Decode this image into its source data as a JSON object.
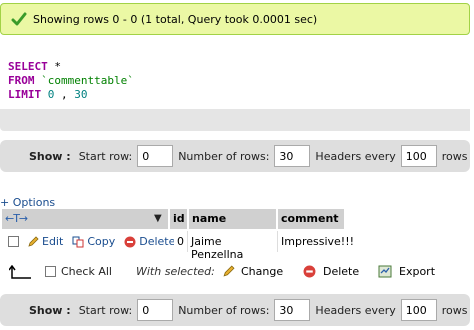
{
  "message": {
    "icon": "checkmark-icon",
    "text": "Showing rows 0 - 0 (1 total, Query took 0.0001 sec)"
  },
  "sql": {
    "select_kw": "SELECT",
    "select_rest": " *",
    "from_kw": "FROM",
    "table": " `commenttable`",
    "limit_kw": "LIMIT",
    "limit_start": " 0",
    "comma": " ,",
    "limit_count": " 30"
  },
  "nav": {
    "show_label": "Show :",
    "start_row_label": "Start row:",
    "start_row_value": "0",
    "num_rows_label": "Number of rows:",
    "num_rows_value": "30",
    "headers_label": "Headers every",
    "headers_value": "100",
    "rows_label": "rows"
  },
  "options_label": "+ Options",
  "table": {
    "arrows": "←T→",
    "sort_icon": "▼",
    "columns": [
      "id",
      "name",
      "comment"
    ],
    "rows": [
      {
        "edit": "Edit",
        "copy": "Copy",
        "delete": "Delete",
        "id": "0",
        "name": "Jaime Penzellna",
        "comment": "Impressive!!!"
      }
    ]
  },
  "bulk": {
    "check_all": "Check All",
    "with_selected": "With selected:",
    "change": "Change",
    "delete": "Delete",
    "export": "Export"
  },
  "colors": {
    "success_bg": "#ebf8a4",
    "success_border": "#a2d246",
    "header_bg": "#d0d0d0",
    "nav_bg": "#dedede",
    "link": "#1a4d8f",
    "keyword": "#990099"
  }
}
